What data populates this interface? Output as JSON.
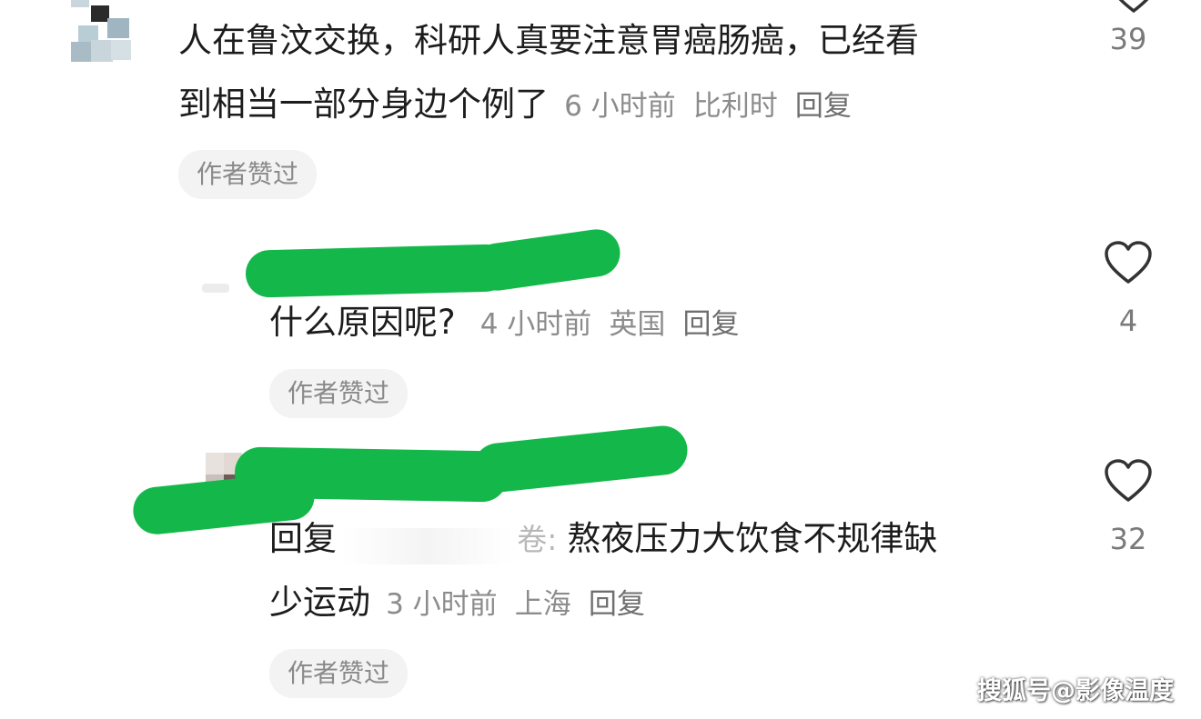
{
  "comments": [
    {
      "text_line1": "人在鲁汶交换，科研人真要注意胃癌肠癌，已经看",
      "text_line2": "到相当一部分身边个例了",
      "time": "6 小时前",
      "location": "比利时",
      "reply_label": "回复",
      "badge": "作者赞过",
      "like_count": "39"
    },
    {
      "text": "什么原因呢?",
      "time": "4 小时前",
      "location": "英国",
      "reply_label": "回复",
      "badge": "作者赞过",
      "like_count": "4"
    },
    {
      "reply_prefix": "回复",
      "quoted_tail": "卷:",
      "text_line1": "熬夜压力大饮食不规律缺",
      "text_line2": "少运动",
      "time": "3 小时前",
      "location": "上海",
      "reply_label": "回复",
      "badge": "作者赞过",
      "like_count": "32"
    }
  ],
  "watermark": "搜狐号@影像温度",
  "colors": {
    "redaction": "#14b84a",
    "badge_bg": "#f3f3f3",
    "meta_text": "#8c8c8c"
  },
  "icons": [
    "heart-icon"
  ]
}
